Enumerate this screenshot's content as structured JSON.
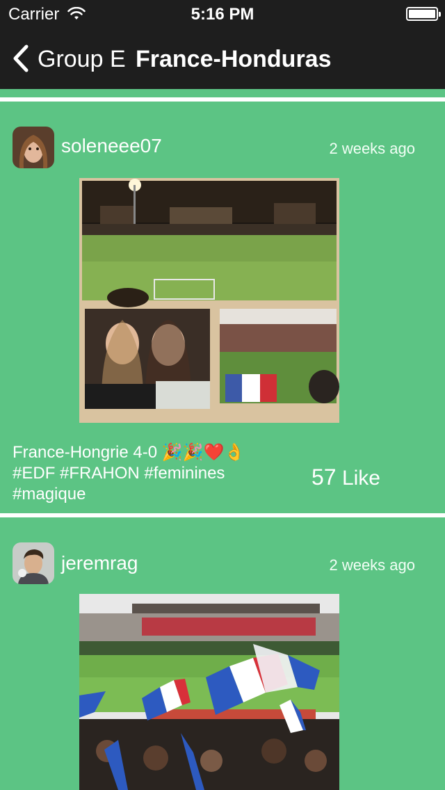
{
  "status_bar": {
    "carrier": "Carrier",
    "time": "5:16 PM",
    "wifi_icon": "wifi-icon",
    "battery_icon": "battery-icon",
    "battery_level": 1.0
  },
  "nav": {
    "back_label": "Group E",
    "title": "France-Honduras",
    "back_icon": "chevron-left-icon"
  },
  "posts": [
    {
      "username": "soleneee07",
      "time_ago": "2 weeks ago",
      "caption_line1": "France-Hongrie 4-0 🎉🎉❤️👌",
      "caption_line2": "#EDF #FRAHON #feminines",
      "caption_line3": "#magique",
      "like_count": "57",
      "like_label": "Like"
    },
    {
      "username": "jeremrag",
      "time_ago": "2 weeks ago"
    }
  ],
  "colors": {
    "background": "#5cc484",
    "bar": "#1e1e1e",
    "separator": "#ffffff"
  }
}
